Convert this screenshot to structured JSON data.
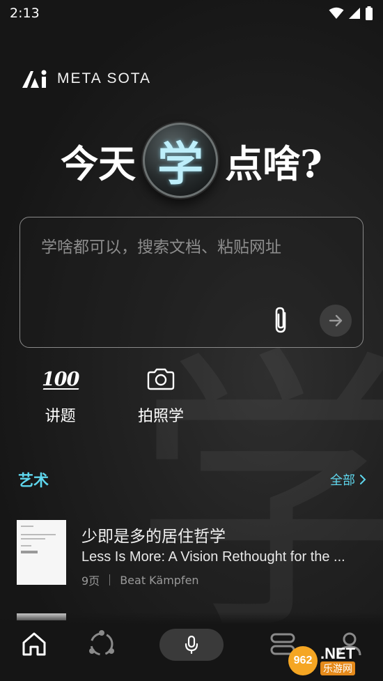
{
  "status_bar": {
    "time": "2:13"
  },
  "brand": {
    "name": "META SOTA"
  },
  "headline": {
    "part1": "今天",
    "highlight": "学",
    "part2": "点啥?"
  },
  "search": {
    "placeholder": "学啥都可以，搜索文档、粘贴网址",
    "attach_icon": "paperclip-icon",
    "submit_icon": "arrow-right-icon"
  },
  "quick_actions": [
    {
      "icon": "100-icon",
      "icon_text": "100",
      "label": "讲题"
    },
    {
      "icon": "camera-icon",
      "label": "拍照学"
    }
  ],
  "section": {
    "title": "艺术",
    "more_label": "全部"
  },
  "documents": [
    {
      "title": "少即是多的居住哲学",
      "subtitle": "Less Is More: A Vision Rethought for the ...",
      "pages": "9页",
      "author": "Beat Kämpfen"
    }
  ],
  "background_char": "学",
  "bottom_nav": {
    "items": [
      "home-icon",
      "discover-icon",
      "mic-icon",
      "library-icon",
      "profile-icon"
    ]
  },
  "watermark_badge": {
    "number": "962",
    "suffix": ".NET",
    "cn": "乐游网"
  },
  "colors": {
    "accent": "#5fd7ee",
    "background": "#171717",
    "highlight_glow": "#bdeefa"
  }
}
